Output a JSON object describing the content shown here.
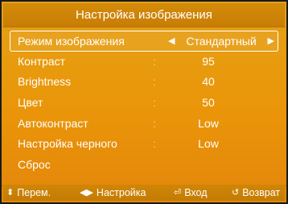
{
  "title": "Настройка изображения",
  "menu": {
    "selected": {
      "label": "Режим изображения",
      "value": "Стандартный",
      "left_arrow_icon": "left-triangle-icon",
      "right_arrow_icon": "right-triangle-icon"
    },
    "items": [
      {
        "label": "Контраст",
        "colon": ":",
        "value": "95"
      },
      {
        "label": "Brightness",
        "colon": ":",
        "value": "40"
      },
      {
        "label": "Цвет",
        "colon": ":",
        "value": "50"
      },
      {
        "label": "Автоконтраст",
        "colon": ":",
        "value": "Low"
      },
      {
        "label": "Настройка черного",
        "colon": ":",
        "value": "Low"
      },
      {
        "label": "Сброс",
        "colon": "",
        "value": ""
      }
    ]
  },
  "footer": {
    "move": {
      "icon": "up-down-arrows-icon",
      "label": "Перем."
    },
    "adjust": {
      "icon": "left-right-arrows-icon",
      "label": "Настройка"
    },
    "enter": {
      "icon": "enter-icon",
      "label": "Вход"
    },
    "return": {
      "icon": "return-icon",
      "label": "Возврат"
    }
  },
  "colors": {
    "panel": "#ea9509",
    "title": "#cc8207",
    "text": "#ffffff"
  }
}
